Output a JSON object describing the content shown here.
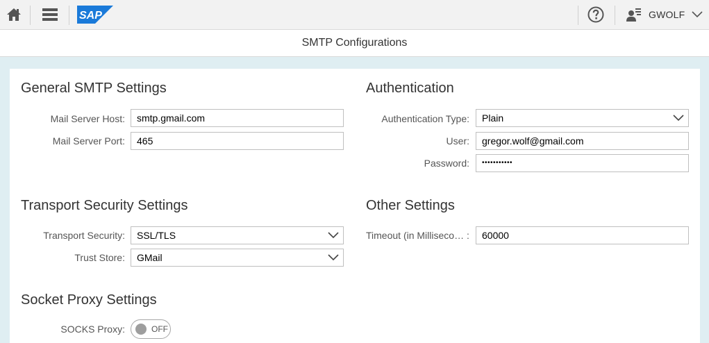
{
  "shell": {
    "logo_text": "SAP",
    "user_name": "GWOLF"
  },
  "page": {
    "title": "SMTP Configurations"
  },
  "general": {
    "title": "General SMTP Settings",
    "host_label": "Mail Server Host:",
    "host_value": "smtp.gmail.com",
    "port_label": "Mail Server Port:",
    "port_value": "465"
  },
  "auth": {
    "title": "Authentication",
    "type_label": "Authentication Type:",
    "type_value": "Plain",
    "user_label": "User:",
    "user_value": "gregor.wolf@gmail.com",
    "password_label": "Password:",
    "password_value": "•••••••••••"
  },
  "transport": {
    "title": "Transport Security Settings",
    "security_label": "Transport Security:",
    "security_value": "SSL/TLS",
    "trust_label": "Trust Store:",
    "trust_value": "GMail"
  },
  "other": {
    "title": "Other Settings",
    "timeout_label": "Timeout (in Milliseco… :",
    "timeout_value": "60000"
  },
  "proxy": {
    "title": "Socket Proxy Settings",
    "socks_label": "SOCKS Proxy:",
    "socks_state": "OFF"
  },
  "colors": {
    "sap_blue": "#1a7ad9",
    "shell_bg": "#f2f2f2",
    "page_bg": "#dfeef2"
  }
}
